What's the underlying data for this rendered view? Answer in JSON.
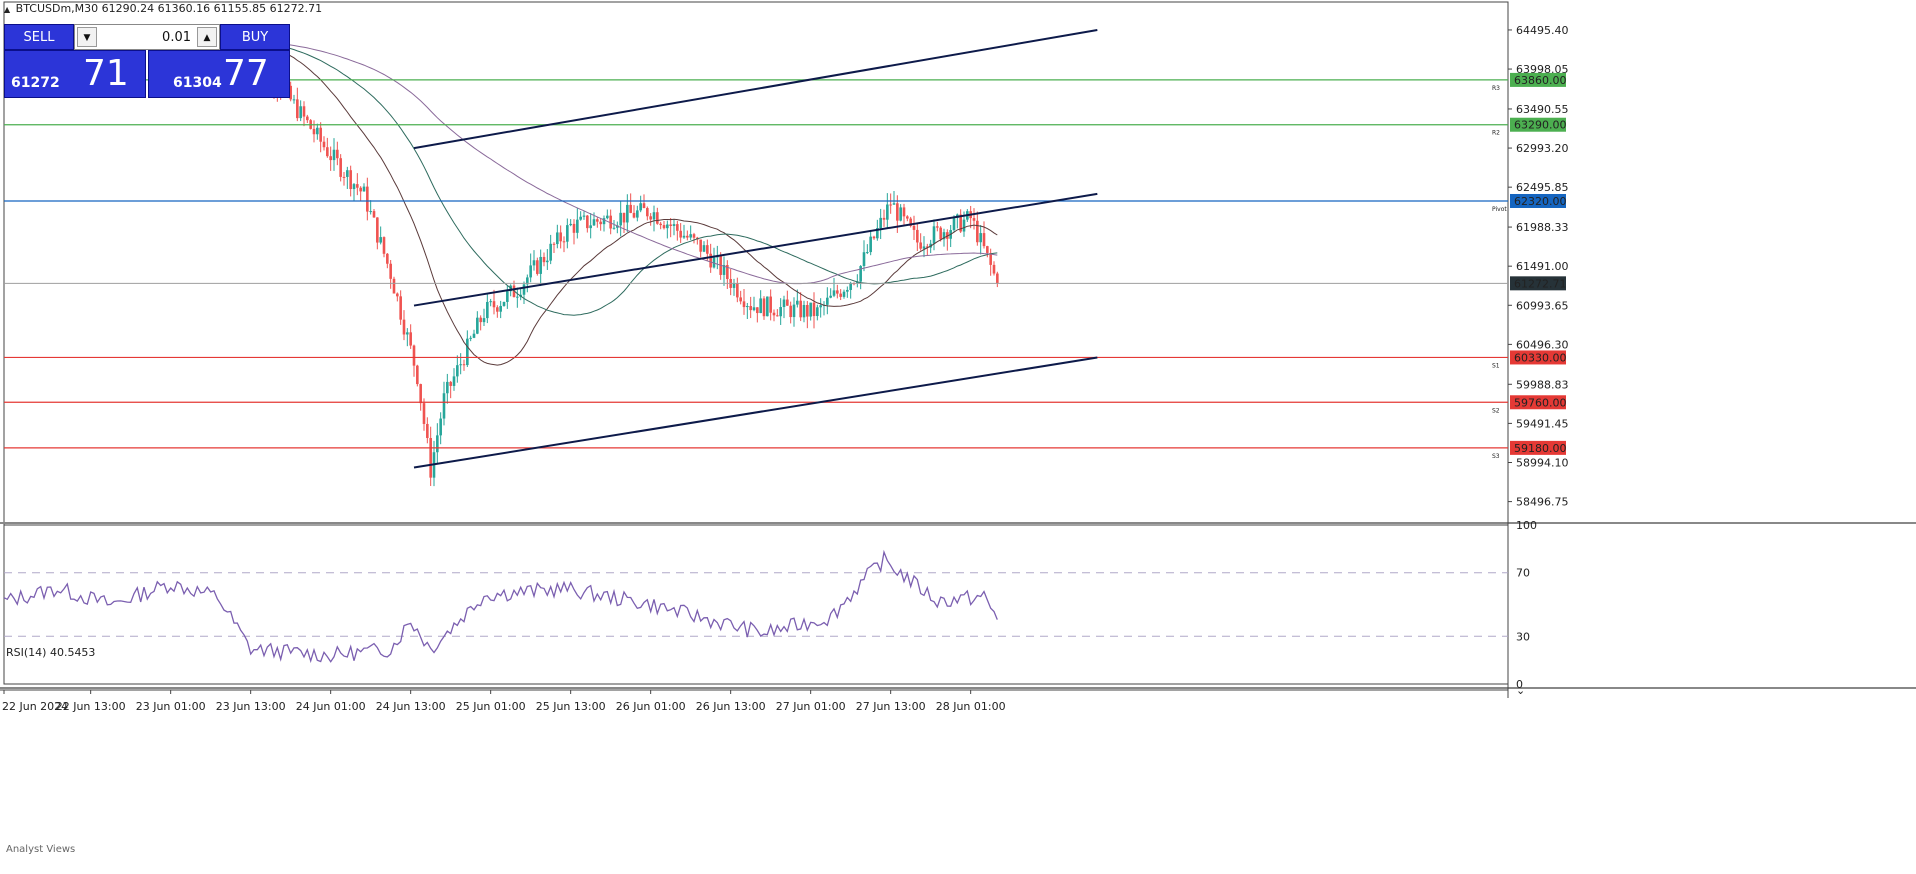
{
  "header": {
    "symbol": "BTCUSDm,M30",
    "ohlc": "61290.24 61360.16 61155.85 61272.71"
  },
  "trade_panel": {
    "sell_label": "SELL",
    "buy_label": "BUY",
    "lot": "0.01",
    "sell_big": "61272",
    "sell_small": "71",
    "buy_big": "61304",
    "buy_small": "77"
  },
  "colors": {
    "bull": "#26a69a",
    "bear": "#ef5350",
    "resistance": "#4caf50",
    "support": "#e53935",
    "pivot": "#1565c0",
    "channel": "#0d1a4a",
    "rsi": "#7b5fb0",
    "ma_fast": "#5a3a3a",
    "ma_mid": "#2e6b5e",
    "ma_slow": "#8a6a9a"
  },
  "status": {
    "analyst_views": "Analyst Views"
  },
  "chart_data": [
    {
      "type": "candlestick",
      "symbol": "BTCUSDm",
      "timeframe": "M30",
      "ylim": [
        58250,
        64800
      ],
      "y_ticks": [
        "64495.40",
        "63998.05",
        "63490.55",
        "62993.20",
        "62495.85",
        "61988.33",
        "61491.00",
        "60993.65",
        "60496.30",
        "59988.83",
        "59491.45",
        "58994.10",
        "58496.75"
      ],
      "x_ticks": [
        "22 Jun 2024",
        "22 Jun 13:00",
        "23 Jun 01:00",
        "23 Jun 13:00",
        "24 Jun 01:00",
        "24 Jun 13:00",
        "25 Jun 01:00",
        "25 Jun 13:00",
        "26 Jun 01:00",
        "26 Jun 13:00",
        "27 Jun 01:00",
        "27 Jun 13:00",
        "28 Jun 01:00"
      ],
      "price_levels": [
        {
          "label": "R3",
          "value": 63860.0,
          "kind": "resistance"
        },
        {
          "label": "R2",
          "value": 63290.0,
          "kind": "resistance"
        },
        {
          "label": "Pivot",
          "value": 62320.0,
          "kind": "pivot"
        },
        {
          "label": "S1",
          "value": 60330.0,
          "kind": "support"
        },
        {
          "label": "S2",
          "value": 59760.0,
          "kind": "support"
        },
        {
          "label": "S3",
          "value": 59180.0,
          "kind": "support"
        }
      ],
      "current_price": "61272.71",
      "channel_lines": [
        {
          "x0": "24 Jun 13:30",
          "y0": 62993,
          "x1": "28 Jun 20:00",
          "y1": 64495
        },
        {
          "x0": "24 Jun 13:30",
          "y0": 60990,
          "x1": "28 Jun 20:00",
          "y1": 62410
        },
        {
          "x0": "24 Jun 13:30",
          "y0": 58930,
          "x1": "28 Jun 20:00",
          "y1": 60330
        }
      ],
      "key_points": [
        {
          "time": "23 Jun 13:00",
          "price": 64300
        },
        {
          "time": "24 Jun 01:00",
          "price": 62900
        },
        {
          "time": "24 Jun 06:00",
          "price": 62400
        },
        {
          "time": "24 Jun 10:00",
          "price": 61400
        },
        {
          "time": "24 Jun 14:00",
          "price": 60100
        },
        {
          "time": "24 Jun 16:00",
          "price": 58900
        },
        {
          "time": "24 Jun 18:00",
          "price": 59800
        },
        {
          "time": "25 Jun 00:00",
          "price": 60900
        },
        {
          "time": "25 Jun 05:00",
          "price": 61200
        },
        {
          "time": "25 Jun 13:00",
          "price": 62000
        },
        {
          "time": "26 Jun 01:00",
          "price": 62200
        },
        {
          "time": "26 Jun 09:00",
          "price": 61700
        },
        {
          "time": "26 Jun 16:00",
          "price": 61000
        },
        {
          "time": "27 Jun 02:00",
          "price": 60900
        },
        {
          "time": "27 Jun 08:00",
          "price": 61400
        },
        {
          "time": "27 Jun 13:00",
          "price": 62300
        },
        {
          "time": "27 Jun 17:00",
          "price": 61800
        },
        {
          "time": "28 Jun 01:00",
          "price": 62100
        },
        {
          "time": "28 Jun 03:00",
          "price": 61700
        },
        {
          "time": "28 Jun 05:00",
          "price": 61272.71
        }
      ]
    },
    {
      "type": "line",
      "title": "RSI(14) 40.5453",
      "ylim": [
        0,
        100
      ],
      "y_ticks": [
        "100",
        "70",
        "30",
        "0"
      ],
      "levels": [
        70,
        30
      ],
      "key_points": [
        {
          "time": "22 Jun 00:00",
          "value": 52
        },
        {
          "time": "22 Jun 08:00",
          "value": 60
        },
        {
          "time": "22 Jun 16:00",
          "value": 50
        },
        {
          "time": "23 Jun 01:00",
          "value": 63
        },
        {
          "time": "23 Jun 08:00",
          "value": 55
        },
        {
          "time": "23 Jun 13:00",
          "value": 22
        },
        {
          "time": "24 Jun 01:00",
          "value": 18
        },
        {
          "time": "24 Jun 10:00",
          "value": 22
        },
        {
          "time": "24 Jun 13:00",
          "value": 40
        },
        {
          "time": "24 Jun 16:00",
          "value": 22
        },
        {
          "time": "25 Jun 00:00",
          "value": 56
        },
        {
          "time": "25 Jun 12:00",
          "value": 60
        },
        {
          "time": "26 Jun 01:00",
          "value": 50
        },
        {
          "time": "26 Jun 12:00",
          "value": 38
        },
        {
          "time": "26 Jun 18:00",
          "value": 32
        },
        {
          "time": "27 Jun 04:00",
          "value": 42
        },
        {
          "time": "27 Jun 10:00",
          "value": 70
        },
        {
          "time": "27 Jun 12:00",
          "value": 78
        },
        {
          "time": "27 Jun 20:00",
          "value": 52
        },
        {
          "time": "28 Jun 03:00",
          "value": 55
        },
        {
          "time": "28 Jun 05:00",
          "value": 40.5
        }
      ]
    }
  ]
}
